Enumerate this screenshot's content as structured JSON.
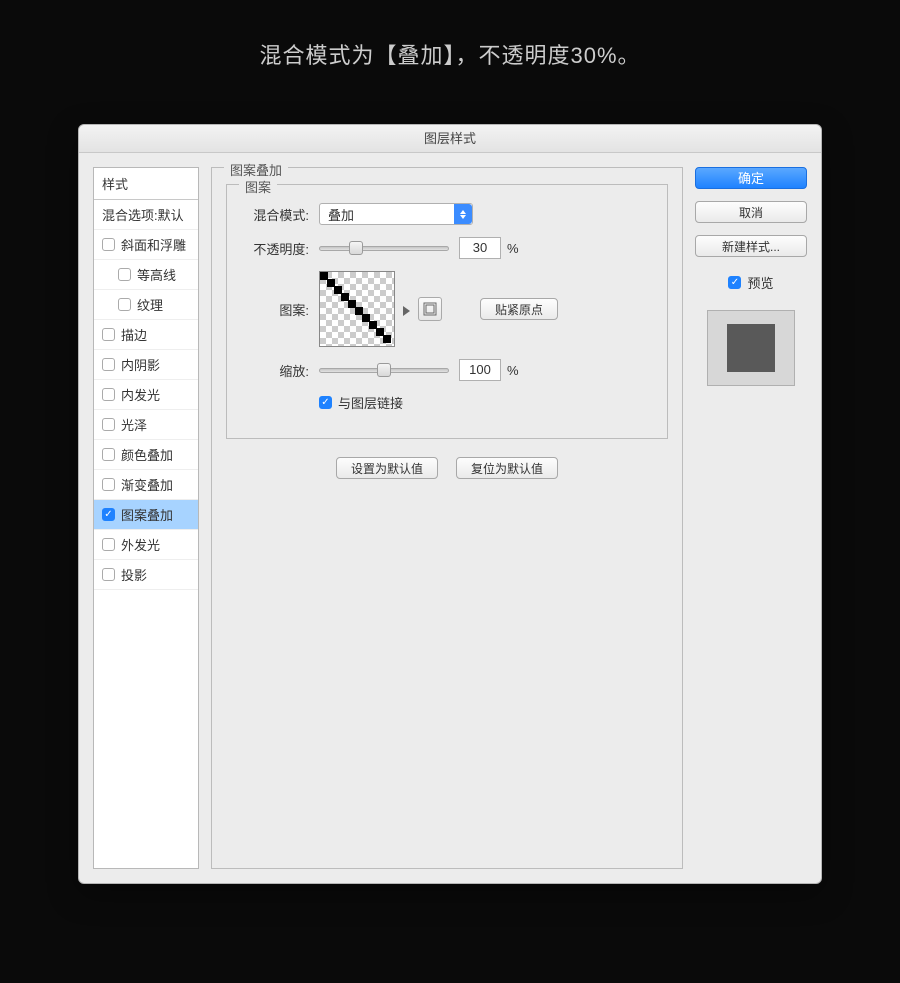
{
  "caption": "混合模式为【叠加】，不透明度30%。",
  "dialog": {
    "title": "图层样式",
    "sidebar": {
      "header": "样式",
      "blending_options": "混合选项:默认",
      "items": [
        {
          "label": "斜面和浮雕",
          "checked": false,
          "indent": false
        },
        {
          "label": "等高线",
          "checked": false,
          "indent": true
        },
        {
          "label": "纹理",
          "checked": false,
          "indent": true
        },
        {
          "label": "描边",
          "checked": false,
          "indent": false
        },
        {
          "label": "内阴影",
          "checked": false,
          "indent": false
        },
        {
          "label": "内发光",
          "checked": false,
          "indent": false
        },
        {
          "label": "光泽",
          "checked": false,
          "indent": false
        },
        {
          "label": "颜色叠加",
          "checked": false,
          "indent": false
        },
        {
          "label": "渐变叠加",
          "checked": false,
          "indent": false
        },
        {
          "label": "图案叠加",
          "checked": true,
          "indent": false,
          "selected": true
        },
        {
          "label": "外发光",
          "checked": false,
          "indent": false
        },
        {
          "label": "投影",
          "checked": false,
          "indent": false
        }
      ]
    },
    "panel": {
      "legend": "图案叠加",
      "inner_legend": "图案",
      "labels": {
        "blend_mode": "混合模式:",
        "opacity": "不透明度:",
        "pattern": "图案:",
        "scale": "缩放:"
      },
      "blend_mode_value": "叠加",
      "opacity_value": "30",
      "scale_value": "100",
      "percent": "%",
      "snap_to_origin": "贴紧原点",
      "link_with_layer": "与图层链接",
      "set_default": "设置为默认值",
      "reset_default": "复位为默认值"
    },
    "buttons": {
      "ok": "确定",
      "cancel": "取消",
      "new_style": "新建样式...",
      "preview": "预览"
    }
  }
}
